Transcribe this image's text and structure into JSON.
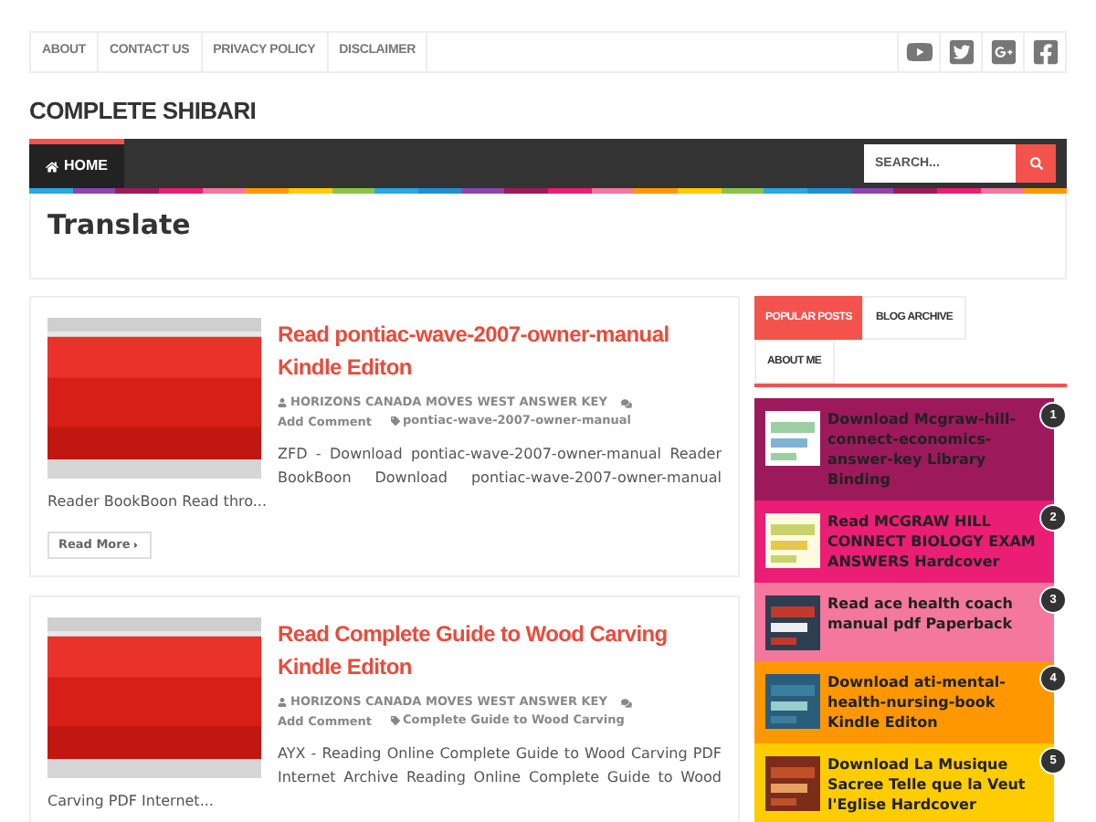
{
  "top_menu": [
    {
      "label": "ABOUT"
    },
    {
      "label": "CONTACT US"
    },
    {
      "label": "PRIVACY POLICY"
    },
    {
      "label": "DISCLAIMER"
    }
  ],
  "social": [
    {
      "kind": "youtube"
    },
    {
      "kind": "twitter"
    },
    {
      "kind": "googleplus"
    },
    {
      "kind": "facebook"
    }
  ],
  "site_title": "COMPLETE SHIBARI",
  "main_nav": [
    {
      "label": "HOME",
      "selected": true
    }
  ],
  "search": {
    "placeholder": "SEARCH..."
  },
  "page_heading": "Translate",
  "posts": [
    {
      "title": "Read pontiac-wave-2007-owner-manual Kindle Editon",
      "author": "HORIZONS CANADA MOVES WEST ANSWER KEY",
      "comments": "Add Comment",
      "tag": "pontiac-wave-2007-owner-manual",
      "excerpt": "ZFD - Download pontiac-wave-2007-owner-manual Reader BookBoon Download pontiac-wave-2007-owner-manual Reader BookBoon Read thro...",
      "read_more": "Read More"
    },
    {
      "title": "Read Complete Guide to Wood Carving Kindle Editon",
      "author": "HORIZONS CANADA MOVES WEST ANSWER KEY",
      "comments": "Add Comment",
      "tag": "Complete Guide to Wood Carving",
      "excerpt": "AYX - Reading Online Complete Guide to Wood Carving PDF Internet Archive Reading Online Complete Guide to Wood Carving PDF Internet..."
    }
  ],
  "sidebar_tabs": [
    {
      "label": "POPULAR POSTS",
      "selected": true
    },
    {
      "label": "BLOG ARCHIVE",
      "selected": false
    },
    {
      "label": "ABOUT ME",
      "selected": false
    }
  ],
  "popular_posts": [
    {
      "rank": "1",
      "title": "Download Mcgraw-hill-connect-economics-answer-key Library Binding",
      "color": "#9c1a5c"
    },
    {
      "rank": "2",
      "title": "Read MCGRAW HILL CONNECT BIOLOGY EXAM ANSWERS Hardcover",
      "color": "#e91e74"
    },
    {
      "rank": "3",
      "title": "Read ace health coach manual pdf Paperback",
      "color": "#f4779e"
    },
    {
      "rank": "4",
      "title": "Download ati-mental-health-nursing-book Kindle Editon",
      "color": "#ff9800"
    },
    {
      "rank": "5",
      "title": "Download La Musique Sacree Telle que la Veut l'Eglise Hardcover",
      "color": "#ffcc00"
    }
  ]
}
